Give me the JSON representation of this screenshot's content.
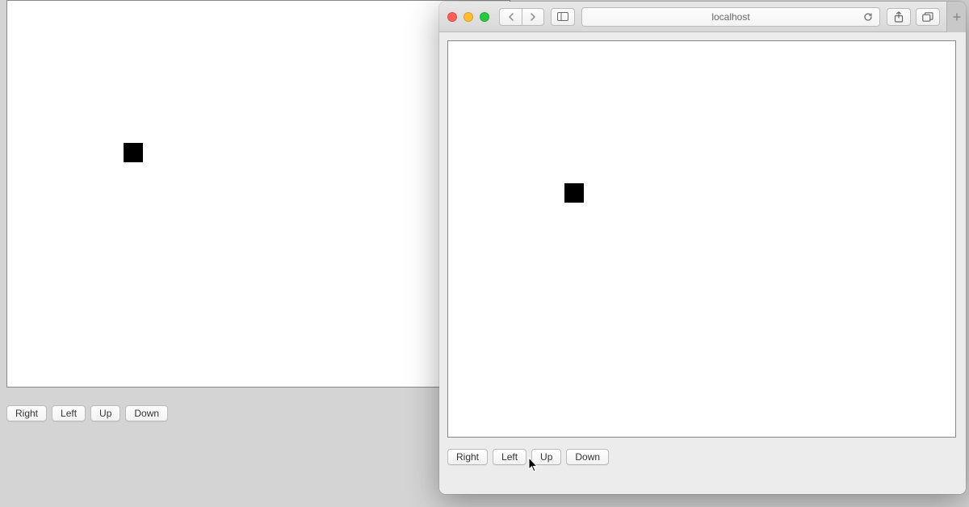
{
  "left_window": {
    "buttons": {
      "right": "Right",
      "left": "Left",
      "up": "Up",
      "down": "Down"
    }
  },
  "safari": {
    "url": "localhost",
    "buttons": {
      "right": "Right",
      "left": "Left",
      "up": "Up",
      "down": "Down"
    }
  }
}
